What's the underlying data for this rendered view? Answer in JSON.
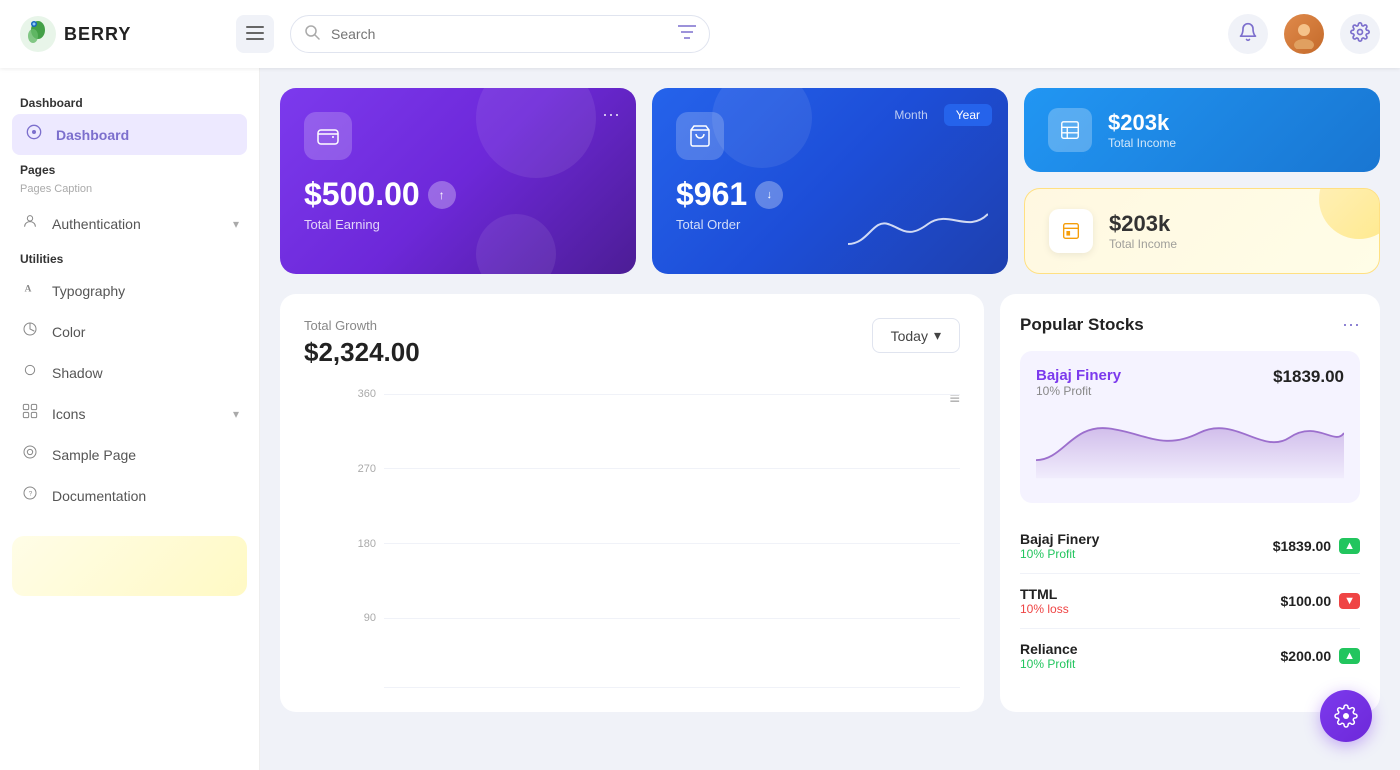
{
  "header": {
    "logo_text": "BERRY",
    "search_placeholder": "Search",
    "menu_icon": "☰"
  },
  "sidebar": {
    "dashboard_section": "Dashboard",
    "dashboard_item": "Dashboard",
    "pages_section": "Pages",
    "pages_caption": "Pages Caption",
    "authentication_item": "Authentication",
    "utilities_section": "Utilities",
    "typography_item": "Typography",
    "color_item": "Color",
    "shadow_item": "Shadow",
    "icons_item": "Icons",
    "sample_page_item": "Sample Page",
    "documentation_item": "Documentation"
  },
  "cards": {
    "total_earning_amount": "$500.00",
    "total_earning_label": "Total Earning",
    "total_order_amount": "$961",
    "total_order_label": "Total Order",
    "month_btn": "Month",
    "year_btn": "Year",
    "total_income_amount_1": "$203k",
    "total_income_label_1": "Total Income",
    "total_income_amount_2": "$203k",
    "total_income_label_2": "Total Income"
  },
  "chart": {
    "section_label": "Total Growth",
    "amount": "$2,324.00",
    "today_btn": "Today",
    "gridlines": [
      360,
      270,
      180,
      90
    ],
    "menu_icon": "≡"
  },
  "stocks": {
    "title": "Popular Stocks",
    "more_icon": "···",
    "featured_name": "Bajaj Finery",
    "featured_price": "$1839.00",
    "featured_profit": "10% Profit",
    "items": [
      {
        "name": "Bajaj Finery",
        "profit": "10% Profit",
        "profit_dir": "up",
        "price": "$1839.00"
      },
      {
        "name": "TTML",
        "profit": "10% loss",
        "profit_dir": "down",
        "price": "$100.00"
      },
      {
        "name": "Reliance",
        "profit": "10% Profit",
        "profit_dir": "up",
        "price": "$200.00"
      }
    ]
  },
  "fab": {
    "icon": "⚙"
  }
}
